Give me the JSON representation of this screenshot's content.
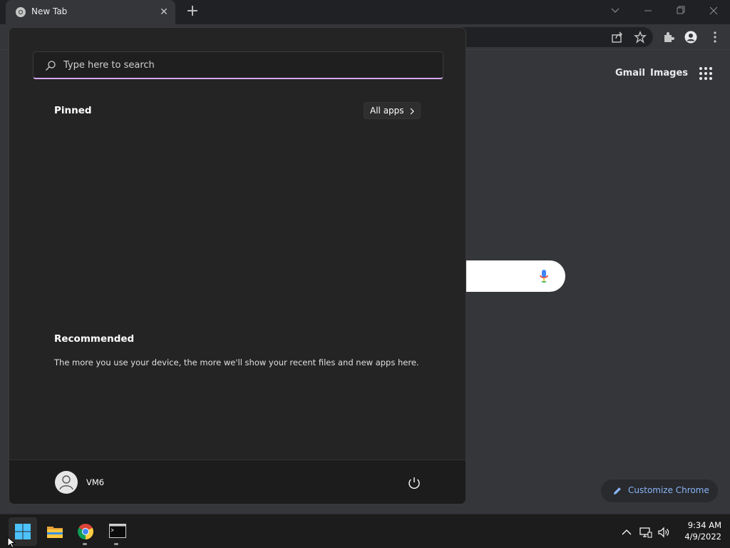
{
  "browser": {
    "tab_title": "New Tab",
    "ntp": {
      "gmail_link": "Gmail",
      "images_link": "Images",
      "customize_label": "Customize Chrome"
    }
  },
  "start_menu": {
    "search_placeholder": "Type here to search",
    "pinned_heading": "Pinned",
    "all_apps_label": "All apps",
    "recommended_heading": "Recommended",
    "recommended_text": "The more you use your device, the more we'll show your recent files and new apps here.",
    "user_name": "VM6"
  },
  "taskbar": {
    "apps": [
      "start-icon",
      "file-explorer-icon",
      "chrome-icon",
      "terminal-icon"
    ],
    "clock_time": "9:34 AM",
    "clock_date": "4/9/2022"
  },
  "colors": {
    "accent": "#d7a7f0",
    "link": "#8ab4f8",
    "start_bg": "#242424"
  }
}
